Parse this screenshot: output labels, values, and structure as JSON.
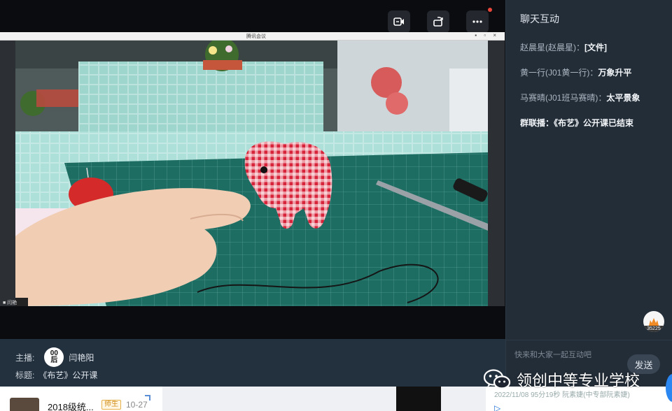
{
  "shared_window": {
    "title": "腾讯会议",
    "corner_label": "■ 闫艳"
  },
  "host": {
    "host_label": "主播:",
    "avatar_text_top": "00",
    "avatar_text_bottom": "后",
    "host_name": "闫艳阳",
    "title_label": "标题:",
    "title": "《布艺》公开课"
  },
  "chat": {
    "header": "聊天互动",
    "messages": [
      {
        "sender": "赵晨星(赵晨星)：",
        "text": "[文件]"
      },
      {
        "sender": "黄一行(J01黄一行)：",
        "text": "万象升平"
      },
      {
        "sender": "马赛晴(J01班马赛晴)：",
        "text": "太平景象"
      },
      {
        "sender": "群联播：",
        "text": "《布艺》公开课已结束"
      }
    ],
    "like_count": "35225",
    "input_placeholder": "快来和大家一起互动吧",
    "send_label": "发送"
  },
  "background_page": {
    "card_title": "2018级统...",
    "card_tag": "师生",
    "card_date": "10-27",
    "timestamp_text": "2022/11/08 95分19秒 阮素婕(中专部阮素婕)",
    "play_glyph": "▷"
  },
  "watermark": {
    "text": "领创中等专业学校"
  },
  "colors": {
    "chat_bg": "#232d38",
    "info_bg": "#23303d",
    "stage_bg": "#0b0c0f",
    "accent_blue": "#2a86f0"
  }
}
